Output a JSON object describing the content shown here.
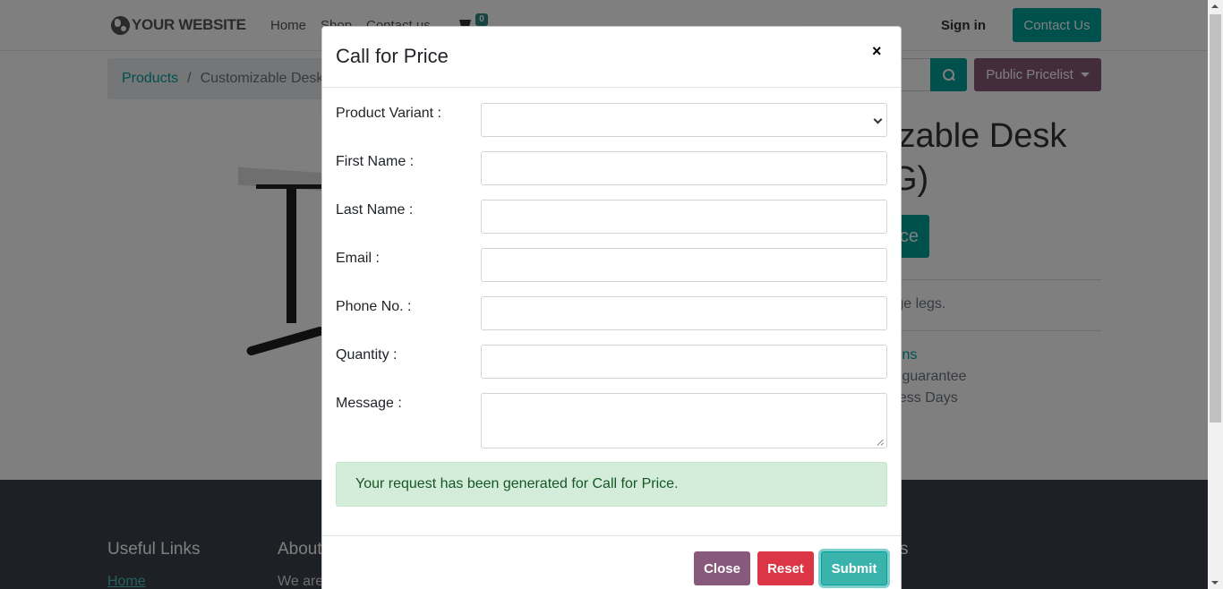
{
  "navbar": {
    "logo_text": "YOUR WEBSITE",
    "links": [
      "Home",
      "Shop",
      "Contact us"
    ],
    "cart_count": "0",
    "sign_in": "Sign in",
    "contact_button": "Contact Us"
  },
  "breadcrumb": {
    "root": "Products",
    "separator": "/",
    "current": "Customizable Desk"
  },
  "toolbar": {
    "pricelist_button": "Public Pricelist"
  },
  "product": {
    "title_partial": "izable Desk\nG)",
    "button_partial": "ce",
    "description_partial": "rge legs.",
    "link_partial": "ions",
    "line1_partial": "k guarantee",
    "line2_partial": "ness Days"
  },
  "footer": {
    "useful_links_heading": "Useful Links",
    "about_heading_partial": "About",
    "right_heading_partial": "s",
    "home_link": "Home",
    "about_text_partial": "We are"
  },
  "modal": {
    "title": "Call for Price",
    "close_symbol": "×",
    "fields": [
      {
        "label": "Product Variant :",
        "type": "select",
        "value": ""
      },
      {
        "label": "First Name :",
        "type": "text",
        "value": ""
      },
      {
        "label": "Last Name :",
        "type": "text",
        "value": ""
      },
      {
        "label": "Email :",
        "type": "text",
        "value": ""
      },
      {
        "label": "Phone No. :",
        "type": "text",
        "value": ""
      },
      {
        "label": "Quantity :",
        "type": "text",
        "value": ""
      },
      {
        "label": "Message :",
        "type": "textarea",
        "value": ""
      }
    ],
    "alert_message": "Your request has been generated for Call for Price.",
    "buttons": {
      "close": "Close",
      "reset": "Reset",
      "submit": "Submit"
    }
  },
  "colors": {
    "primary": "#00A09D",
    "secondary": "#875A7B",
    "danger": "#dc3545",
    "success_bg": "#d4edda",
    "success_text": "#155724",
    "footer_bg": "#3b4149"
  }
}
